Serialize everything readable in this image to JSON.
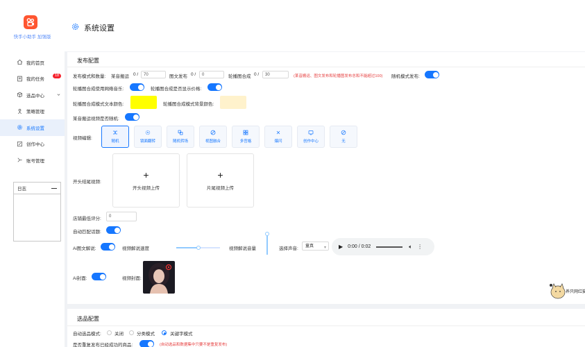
{
  "app": {
    "name": "快手小助手 加强版",
    "page_title": "系统设置",
    "brand_color": "#ff5530",
    "accent": "#1677ff"
  },
  "sidebar": {
    "items": [
      {
        "label": "我的首页",
        "icon": "home-icon"
      },
      {
        "label": "我的任务",
        "icon": "task-icon",
        "badge": "18"
      },
      {
        "label": "选品中心",
        "icon": "product-icon"
      },
      {
        "label": "策略管理",
        "icon": "strategy-icon"
      },
      {
        "label": "系统设置",
        "icon": "gear-icon",
        "active": true
      },
      {
        "label": "创作中心",
        "icon": "edit-icon"
      },
      {
        "label": "账号管理",
        "icon": "account-icon"
      }
    ],
    "log_title": "日志"
  },
  "publish": {
    "title": "发布配置",
    "mode_label": "发布模式和数量:",
    "mode_items": [
      {
        "label": "某音搬运",
        "prefix": "0 /",
        "value": "70"
      },
      {
        "label": "图文发布",
        "prefix": "0 /",
        "value": "0"
      },
      {
        "label": "轮播图合成",
        "prefix": "0 /",
        "value": "30"
      }
    ],
    "mode_note": "(某音搬运、图文发布和轮播图发布总和不能超过100)",
    "random_mode_label": "随机模式发布:",
    "carousel_music_label": "轮播图合成使用网络音乐:",
    "carousel_price_label": "轮播图合成是否显示价格:",
    "text_color_label": "轮播图合成模式文本颜色:",
    "text_color": "#ffff00",
    "bg_color_label": "轮播图合成模式背景颜色:",
    "bg_color": "#fff2cc",
    "random_video_label": "某音搬运视频是否随机:",
    "edit_label": "视频编辑:",
    "edit_options": [
      {
        "label": "随机",
        "icon": "shuffle-icon",
        "selected": true
      },
      {
        "label": "镜面翻转",
        "icon": "mirror-icon"
      },
      {
        "label": "随机转场",
        "icon": "transition-icon"
      },
      {
        "label": "视图融合",
        "icon": "blend-icon"
      },
      {
        "label": "多宫格",
        "icon": "grid-icon"
      },
      {
        "label": "爆闪",
        "icon": "flash-icon"
      },
      {
        "label": "创作中心",
        "icon": "creator-icon"
      },
      {
        "label": "无",
        "icon": "none-icon"
      }
    ],
    "head_tail_label": "开头结尾视频:",
    "upload_head": "开头视频上传",
    "upload_tail": "片尾视频上传",
    "shop_score_label": "店铺最低评分:",
    "shop_score_value": "0",
    "auto_topic_label": "自动匹配话题:",
    "ai_text_label": "Ai图文解说:",
    "speed_label": "视频解说速度",
    "speed_value": 0.5,
    "volume_label": "视频解说音量",
    "volume_value": 1.0,
    "voice_label": "选择声音:",
    "voice_value": "童真",
    "audio_time": "0:00 / 0:02",
    "ai_cover_label": "Ai封面:",
    "cover_label": "视频封面:"
  },
  "selection": {
    "title": "选品配置",
    "auto_label": "自动选品模式:",
    "options": [
      {
        "label": "关闭",
        "selected": false
      },
      {
        "label": "分类模式",
        "selected": false
      },
      {
        "label": "关键字模式",
        "selected": true
      }
    ],
    "repeat_label": "是否重复发布已经成功的商品:",
    "repeat_note": "(自动选品和数据集中只要不是重复发布)"
  },
  "watermark": {
    "text": "养只网红猫",
    "icon": "cat-icon"
  }
}
